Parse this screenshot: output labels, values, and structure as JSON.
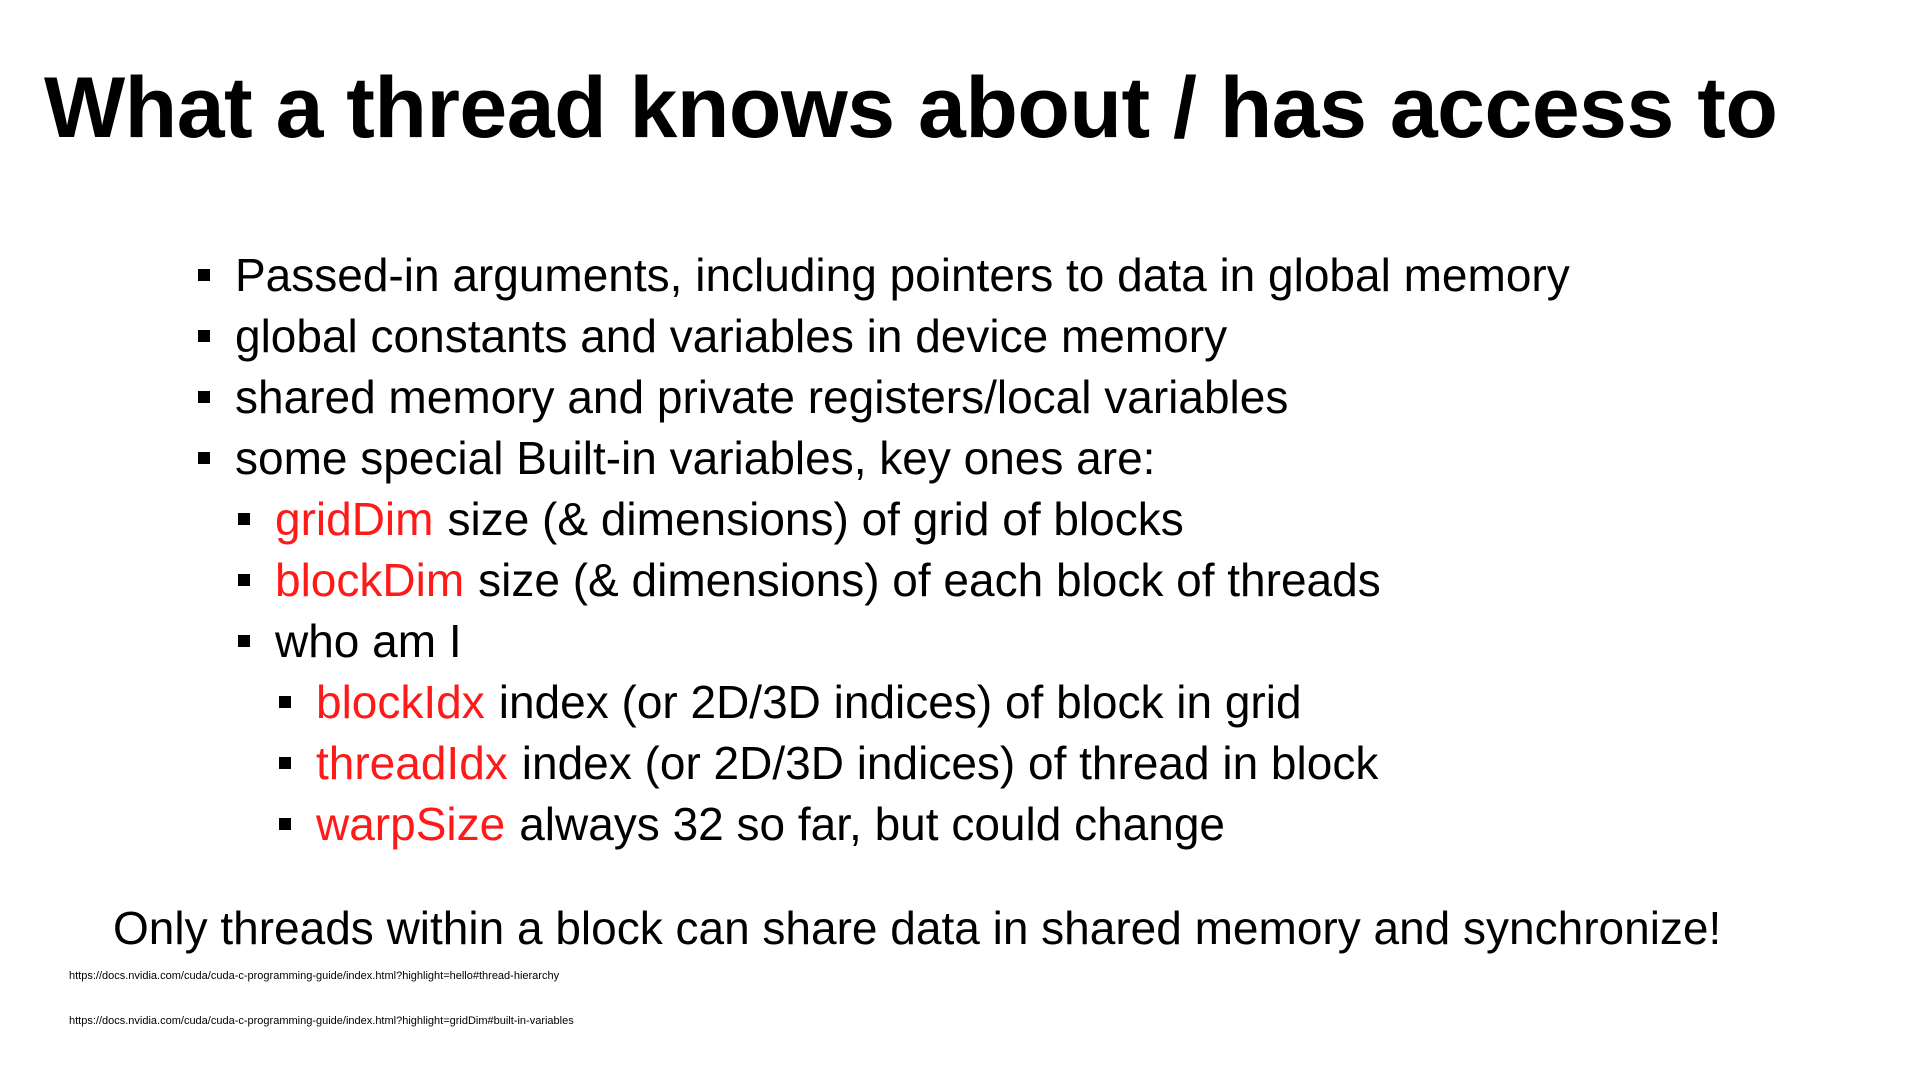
{
  "slide": {
    "title": "What a thread knows about / has access to",
    "bullets": [
      {
        "term": "",
        "text": "Passed-in arguments, including pointers to data in global memory"
      },
      {
        "term": "",
        "text": "global constants and variables in device memory"
      },
      {
        "term": "",
        "text": "shared memory and private registers/local variables"
      },
      {
        "term": "",
        "text": "some special Built-in variables, key ones are:"
      },
      {
        "term": "gridDim",
        "text": "size (& dimensions) of grid of blocks"
      },
      {
        "term": "blockDim",
        "text": "size (& dimensions) of each block of threads"
      },
      {
        "term": "",
        "text": "who am I"
      },
      {
        "term": "blockIdx",
        "text": "index (or 2D/3D indices) of block in grid"
      },
      {
        "term": "threadIdx",
        "text": "index (or 2D/3D indices) of thread in block"
      },
      {
        "term": "warpSize",
        "text": "always 32 so far, but could change"
      }
    ],
    "closing": "Only threads within a block can share data in shared memory and synchronize!",
    "references": [
      "https://docs.nvidia.com/cuda/cuda-c-programming-guide/index.html?highlight=hello#thread-hierarchy",
      "https://docs.nvidia.com/cuda/cuda-c-programming-guide/index.html?highlight=gridDim#built-in-variables"
    ]
  },
  "colors": {
    "text": "#000000",
    "highlight": "#ff1a1a",
    "background": "#ffffff"
  }
}
